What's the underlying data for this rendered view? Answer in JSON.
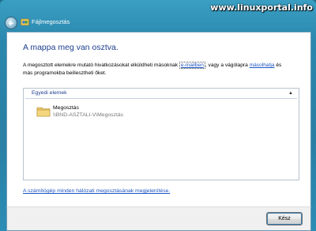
{
  "watermark": "www.linuxportal.info",
  "window": {
    "title": "Fájlmegosztás"
  },
  "main": {
    "heading": "A mappa meg van osztva.",
    "desc_part1": "A megosztott elemekre mutató hivatkozásokat elküldheti másoknak ",
    "desc_link_email": "e-mailben",
    "desc_part2": ", vagy a vágólapra ",
    "desc_link_copy": "másolhatja",
    "desc_part3": " és más programokba beillesztheti őket.",
    "group_label": "Egyedi elemek",
    "share_name": "Megosztás",
    "share_path": "\\\\BND-ASZTALI-V\\Megosztás",
    "bottom_link": "A számítógép minden hálózati megosztásának megjelenítése."
  },
  "footer": {
    "ok_label": "Kész"
  },
  "colors": {
    "heading": "#1e3f8f",
    "link": "#1e56c2",
    "frame": "#2a7fa4"
  }
}
